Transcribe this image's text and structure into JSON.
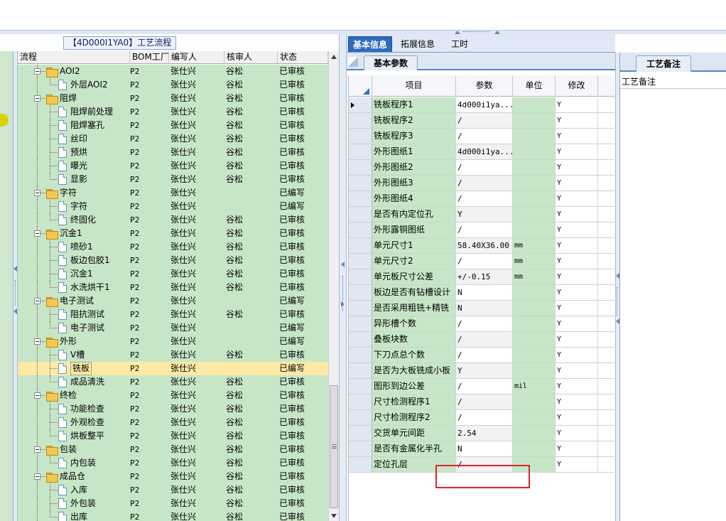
{
  "tree_panel": {
    "title": "【4D000I1YA0】工艺流程",
    "columns": [
      "流程",
      "BOM工厂",
      "编写人",
      "核审人",
      "状态"
    ]
  },
  "tree_rows": [
    {
      "level": 1,
      "type": "folder",
      "name": "AOI2",
      "bom": "P2",
      "writer": "张仕兴",
      "checker": "谷松",
      "status": "已审核"
    },
    {
      "level": 2,
      "type": "doc",
      "name": "外层AOI2",
      "bom": "P2",
      "writer": "张仕兴",
      "checker": "谷松",
      "status": "已审核"
    },
    {
      "level": 1,
      "type": "folder",
      "name": "阻焊",
      "bom": "P2",
      "writer": "张仕兴",
      "checker": "谷松",
      "status": "已审核"
    },
    {
      "level": 2,
      "type": "doc",
      "name": "阻焊前处理",
      "bom": "P2",
      "writer": "张仕兴",
      "checker": "谷松",
      "status": "已审核"
    },
    {
      "level": 2,
      "type": "doc",
      "name": "阻焊塞孔",
      "bom": "P2",
      "writer": "张仕兴",
      "checker": "谷松",
      "status": "已审核"
    },
    {
      "level": 2,
      "type": "doc",
      "name": "丝印",
      "bom": "P2",
      "writer": "张仕兴",
      "checker": "谷松",
      "status": "已审核"
    },
    {
      "level": 2,
      "type": "doc",
      "name": "预烘",
      "bom": "P2",
      "writer": "张仕兴",
      "checker": "谷松",
      "status": "已审核"
    },
    {
      "level": 2,
      "type": "doc",
      "name": "曝光",
      "bom": "P2",
      "writer": "张仕兴",
      "checker": "谷松",
      "status": "已审核"
    },
    {
      "level": 2,
      "type": "doc",
      "name": "显影",
      "bom": "P2",
      "writer": "张仕兴",
      "checker": "谷松",
      "status": "已审核"
    },
    {
      "level": 1,
      "type": "folder",
      "name": "字符",
      "bom": "P2",
      "writer": "张仕兴",
      "checker": "",
      "status": "已编写"
    },
    {
      "level": 2,
      "type": "doc",
      "name": "字符",
      "bom": "P2",
      "writer": "张仕兴",
      "checker": "",
      "status": "已编写"
    },
    {
      "level": 2,
      "type": "doc",
      "name": "终固化",
      "bom": "P2",
      "writer": "张仕兴",
      "checker": "谷松",
      "status": "已审核"
    },
    {
      "level": 1,
      "type": "folder",
      "name": "沉金1",
      "bom": "P2",
      "writer": "张仕兴",
      "checker": "谷松",
      "status": "已审核"
    },
    {
      "level": 2,
      "type": "doc",
      "name": "喷砂1",
      "bom": "P2",
      "writer": "张仕兴",
      "checker": "谷松",
      "status": "已审核"
    },
    {
      "level": 2,
      "type": "doc",
      "name": "板边包胶1",
      "bom": "P2",
      "writer": "张仕兴",
      "checker": "谷松",
      "status": "已审核"
    },
    {
      "level": 2,
      "type": "doc",
      "name": "沉金1",
      "bom": "P2",
      "writer": "张仕兴",
      "checker": "谷松",
      "status": "已审核"
    },
    {
      "level": 2,
      "type": "doc",
      "name": "水洗烘干1",
      "bom": "P2",
      "writer": "张仕兴",
      "checker": "谷松",
      "status": "已审核"
    },
    {
      "level": 1,
      "type": "folder",
      "name": "电子测试",
      "bom": "P2",
      "writer": "张仕兴",
      "checker": "",
      "status": "已编写"
    },
    {
      "level": 2,
      "type": "doc",
      "name": "阻抗测试",
      "bom": "P2",
      "writer": "张仕兴",
      "checker": "谷松",
      "status": "已审核"
    },
    {
      "level": 2,
      "type": "doc",
      "name": "电子测试",
      "bom": "P2",
      "writer": "张仕兴",
      "checker": "",
      "status": "已编写"
    },
    {
      "level": 1,
      "type": "folder",
      "name": "外形",
      "bom": "P2",
      "writer": "张仕兴",
      "checker": "",
      "status": "已编写"
    },
    {
      "level": 2,
      "type": "doc",
      "name": "V槽",
      "bom": "P2",
      "writer": "张仕兴",
      "checker": "谷松",
      "status": "已审核"
    },
    {
      "level": 2,
      "type": "doc",
      "name": "铣板",
      "bom": "P2",
      "writer": "张仕兴",
      "checker": "",
      "status": "已编写",
      "selected": true
    },
    {
      "level": 2,
      "type": "doc",
      "name": "成品清洗",
      "bom": "P2",
      "writer": "张仕兴",
      "checker": "谷松",
      "status": "已审核"
    },
    {
      "level": 1,
      "type": "folder",
      "name": "终检",
      "bom": "P2",
      "writer": "张仕兴",
      "checker": "谷松",
      "status": "已审核"
    },
    {
      "level": 2,
      "type": "doc",
      "name": "功能检查",
      "bom": "P2",
      "writer": "张仕兴",
      "checker": "谷松",
      "status": "已审核"
    },
    {
      "level": 2,
      "type": "doc",
      "name": "外观检查",
      "bom": "P2",
      "writer": "张仕兴",
      "checker": "谷松",
      "status": "已审核"
    },
    {
      "level": 2,
      "type": "doc",
      "name": "烘板整平",
      "bom": "P2",
      "writer": "张仕兴",
      "checker": "谷松",
      "status": "已审核"
    },
    {
      "level": 1,
      "type": "folder",
      "name": "包装",
      "bom": "P2",
      "writer": "张仕兴",
      "checker": "谷松",
      "status": "已审核"
    },
    {
      "level": 2,
      "type": "doc",
      "name": "内包装",
      "bom": "P2",
      "writer": "张仕兴",
      "checker": "谷松",
      "status": "已审核"
    },
    {
      "level": 1,
      "type": "folder",
      "name": "成品仓",
      "bom": "P2",
      "writer": "张仕兴",
      "checker": "谷松",
      "status": "已审核"
    },
    {
      "level": 2,
      "type": "doc",
      "name": "入库",
      "bom": "P2",
      "writer": "张仕兴",
      "checker": "谷松",
      "status": "已审核"
    },
    {
      "level": 2,
      "type": "doc",
      "name": "外包装",
      "bom": "P2",
      "writer": "张仕兴",
      "checker": "谷松",
      "status": "已审核"
    },
    {
      "level": 2,
      "type": "doc",
      "name": "出库",
      "bom": "P2",
      "writer": "张仕兴",
      "checker": "谷松",
      "status": "已审核"
    }
  ],
  "mid_panel": {
    "tabs": [
      "基本信息",
      "拓展信息",
      "工时"
    ],
    "active_tab": 0,
    "sub_tab": "基本参数",
    "columns": [
      "项目",
      "参数",
      "单位",
      "修改"
    ]
  },
  "param_rows": [
    {
      "item": "铣板程序1",
      "param": "4d000i1ya...",
      "unit": "",
      "mod": "Y",
      "current": true
    },
    {
      "item": "铣板程序2",
      "param": "/",
      "unit": "",
      "mod": "Y"
    },
    {
      "item": "铣板程序3",
      "param": "/",
      "unit": "",
      "mod": "Y"
    },
    {
      "item": "外形图纸1",
      "param": "4d000i1ya...",
      "unit": "",
      "mod": "Y"
    },
    {
      "item": "外形图纸2",
      "param": "/",
      "unit": "",
      "mod": "Y"
    },
    {
      "item": "外形图纸3",
      "param": "/",
      "unit": "",
      "mod": "Y"
    },
    {
      "item": "外形图纸4",
      "param": "/",
      "unit": "",
      "mod": "Y"
    },
    {
      "item": "是否有内定位孔",
      "param": "Y",
      "unit": "",
      "mod": "Y"
    },
    {
      "item": "外形露铜图纸",
      "param": "/",
      "unit": "",
      "mod": "Y"
    },
    {
      "item": "单元尺寸1",
      "param": "58.40X36.00",
      "unit": "mm",
      "mod": "Y"
    },
    {
      "item": "单元尺寸2",
      "param": "/",
      "unit": "mm",
      "mod": "Y"
    },
    {
      "item": "单元板尺寸公差",
      "param": "+/-0.15",
      "unit": "mm",
      "mod": "Y"
    },
    {
      "item": "板边是否有钻槽设计",
      "param": "N",
      "unit": "",
      "mod": "Y"
    },
    {
      "item": "是否采用粗铣+精铣",
      "param": "N",
      "unit": "",
      "mod": "Y"
    },
    {
      "item": "异形槽个数",
      "param": "/",
      "unit": "",
      "mod": "Y"
    },
    {
      "item": "叠板块数",
      "param": "/",
      "unit": "",
      "mod": "Y"
    },
    {
      "item": "下刀点总个数",
      "param": "/",
      "unit": "",
      "mod": "Y"
    },
    {
      "item": "是否为大板铣成小板",
      "param": "Y",
      "unit": "",
      "mod": "Y"
    },
    {
      "item": "图形到边公差",
      "param": "/",
      "unit": "mil",
      "mod": "Y"
    },
    {
      "item": "尺寸检测程序1",
      "param": "/",
      "unit": "",
      "mod": "Y"
    },
    {
      "item": "尺寸检测程序2",
      "param": "/",
      "unit": "",
      "mod": "Y"
    },
    {
      "item": "交货单元间距",
      "param": "2.54",
      "unit": "",
      "mod": "Y"
    },
    {
      "item": "是否有金属化半孔",
      "param": "N",
      "unit": "",
      "mod": "Y"
    },
    {
      "item": "定位孔层",
      "param": "/",
      "unit": "",
      "mod": "Y"
    }
  ],
  "right_panel": {
    "tab": "工艺备注",
    "label": "工艺备注"
  },
  "colors": {
    "row_green": "#c7e6c7",
    "selected_row": "#fde9a6",
    "active_tab": "#2e6bc0",
    "highlight_box": "#d9262c"
  },
  "icons": {
    "folder": "folder-icon",
    "document": "document-icon",
    "expander": "collapse-minus-icon",
    "current_row": "row-pointer-icon"
  }
}
